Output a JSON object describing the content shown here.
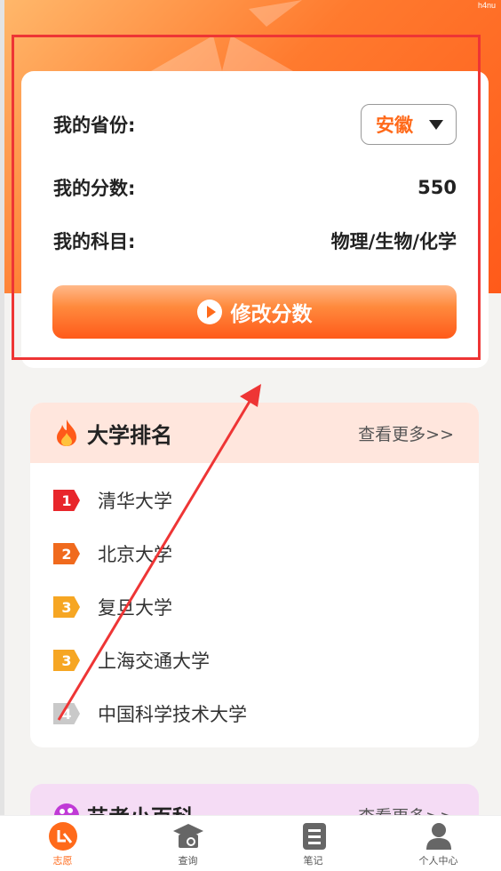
{
  "watermark": "h4nu",
  "score_card": {
    "province_label": "我的省份:",
    "province_value": "安徽",
    "score_label": "我的分数:",
    "score_value": "550",
    "subjects_label": "我的科目:",
    "subjects_value": "物理/生物/化学",
    "edit_button": "修改分数"
  },
  "ranking": {
    "title": "大学排名",
    "more": "查看更多>>",
    "items": [
      {
        "rank": "1",
        "name": "清华大学",
        "color": "#e8262b"
      },
      {
        "rank": "2",
        "name": "北京大学",
        "color": "#f06a1d"
      },
      {
        "rank": "3",
        "name": "复旦大学",
        "color": "#f6a623"
      },
      {
        "rank": "3",
        "name": "上海交通大学",
        "color": "#f6a623"
      },
      {
        "rank": "4",
        "name": "中国科学技术大学",
        "color": "#c9c9c9"
      }
    ]
  },
  "art": {
    "title": "艺考小百科",
    "more": "查看更多>>"
  },
  "tabbar": [
    {
      "label": "志愿",
      "icon": "wish-icon",
      "active": true
    },
    {
      "label": "查询",
      "icon": "query-icon",
      "active": false
    },
    {
      "label": "笔记",
      "icon": "notes-icon",
      "active": false
    },
    {
      "label": "个人中心",
      "icon": "profile-icon",
      "active": false
    }
  ],
  "colors": {
    "accent": "#ff6a1a",
    "annotation": "#ee3535"
  }
}
